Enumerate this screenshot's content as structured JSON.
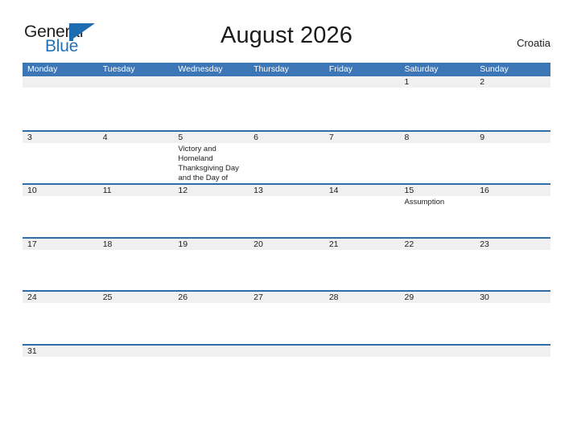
{
  "brand": {
    "name_part1": "General",
    "name_part2": "Blue",
    "logo_icon": "sail-flag-icon"
  },
  "header": {
    "title": "August 2026",
    "region": "Croatia"
  },
  "colors": {
    "header_blue": "#3c76b6",
    "row_divider_blue": "#2f6ca8",
    "date_strip_gray": "#f0f0f0",
    "brand_blue": "#2272b5",
    "text_dark": "#1c1c1c"
  },
  "calendar": {
    "day_names": [
      "Monday",
      "Tuesday",
      "Wednesday",
      "Thursday",
      "Friday",
      "Saturday",
      "Sunday"
    ],
    "weeks": [
      [
        {
          "date": "",
          "events": []
        },
        {
          "date": "",
          "events": []
        },
        {
          "date": "",
          "events": []
        },
        {
          "date": "",
          "events": []
        },
        {
          "date": "",
          "events": []
        },
        {
          "date": "1",
          "events": []
        },
        {
          "date": "2",
          "events": []
        }
      ],
      [
        {
          "date": "3",
          "events": []
        },
        {
          "date": "4",
          "events": []
        },
        {
          "date": "5",
          "events": [
            "Victory and Homeland Thanksgiving Day and the Day of Croatian Defenders"
          ]
        },
        {
          "date": "6",
          "events": []
        },
        {
          "date": "7",
          "events": []
        },
        {
          "date": "8",
          "events": []
        },
        {
          "date": "9",
          "events": []
        }
      ],
      [
        {
          "date": "10",
          "events": []
        },
        {
          "date": "11",
          "events": []
        },
        {
          "date": "12",
          "events": []
        },
        {
          "date": "13",
          "events": []
        },
        {
          "date": "14",
          "events": []
        },
        {
          "date": "15",
          "events": [
            "Assumption"
          ]
        },
        {
          "date": "16",
          "events": []
        }
      ],
      [
        {
          "date": "17",
          "events": []
        },
        {
          "date": "18",
          "events": []
        },
        {
          "date": "19",
          "events": []
        },
        {
          "date": "20",
          "events": []
        },
        {
          "date": "21",
          "events": []
        },
        {
          "date": "22",
          "events": []
        },
        {
          "date": "23",
          "events": []
        }
      ],
      [
        {
          "date": "24",
          "events": []
        },
        {
          "date": "25",
          "events": []
        },
        {
          "date": "26",
          "events": []
        },
        {
          "date": "27",
          "events": []
        },
        {
          "date": "28",
          "events": []
        },
        {
          "date": "29",
          "events": []
        },
        {
          "date": "30",
          "events": []
        }
      ],
      [
        {
          "date": "31",
          "events": []
        },
        {
          "date": "",
          "events": []
        },
        {
          "date": "",
          "events": []
        },
        {
          "date": "",
          "events": []
        },
        {
          "date": "",
          "events": []
        },
        {
          "date": "",
          "events": []
        },
        {
          "date": "",
          "events": []
        }
      ]
    ]
  }
}
